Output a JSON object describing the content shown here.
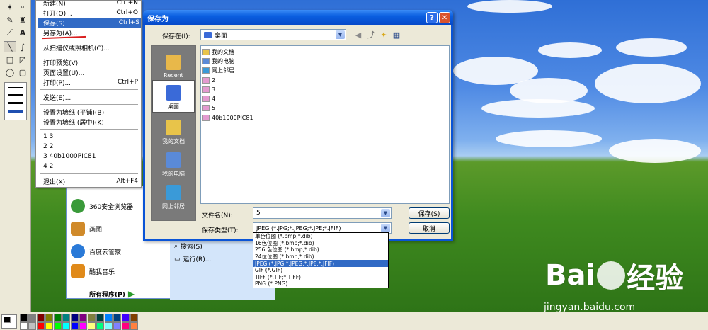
{
  "file_menu": {
    "items": [
      {
        "label": "新建(N)",
        "shortcut": "Ctrl+N"
      },
      {
        "label": "打开(O)...",
        "shortcut": "Ctrl+O"
      },
      {
        "label": "保存(S)",
        "shortcut": "Ctrl+S"
      },
      {
        "label": "另存为(A)...",
        "shortcut": ""
      },
      {
        "label": "从扫描仪或照相机(C)...",
        "shortcut": ""
      },
      {
        "label": "打印预览(V)",
        "shortcut": ""
      },
      {
        "label": "页面设置(U)...",
        "shortcut": ""
      },
      {
        "label": "打印(P)...",
        "shortcut": "Ctrl+P"
      },
      {
        "label": "发送(E)...",
        "shortcut": ""
      },
      {
        "label": "设置为墙纸 (平铺)(B)",
        "shortcut": ""
      },
      {
        "label": "设置为墙纸 (居中)(K)",
        "shortcut": ""
      },
      {
        "label": "1 3",
        "shortcut": ""
      },
      {
        "label": "2 2",
        "shortcut": ""
      },
      {
        "label": "3 40b1000PIC81",
        "shortcut": ""
      },
      {
        "label": "4 2",
        "shortcut": ""
      },
      {
        "label": "退出(X)",
        "shortcut": "Alt+F4"
      }
    ]
  },
  "start_menu": {
    "items": [
      {
        "label": "360安全浏览器",
        "color": "#3a9a3a"
      },
      {
        "label": "画图",
        "color": "#d08a2a"
      },
      {
        "label": "百度云管家",
        "color": "#2a7ad8"
      },
      {
        "label": "酷我音乐",
        "color": "#e08a1a"
      }
    ],
    "all_programs": "所有程序(P)",
    "search_label": "搜索(S)",
    "run_label": "运行(R)..."
  },
  "dialog": {
    "title": "保存为",
    "help_glyph": "?",
    "close_glyph": "✕",
    "save_in_label": "保存在(I):",
    "save_in_value": "桌面",
    "places": [
      {
        "label": "Recent",
        "color": "#e8b84a"
      },
      {
        "label": "桌面",
        "color": "#3a6ad8"
      },
      {
        "label": "我的文档",
        "color": "#e8c44a"
      },
      {
        "label": "我的电脑",
        "color": "#5a8ad8"
      },
      {
        "label": "网上邻居",
        "color": "#3a9ad8"
      }
    ],
    "files": [
      "我的文档",
      "我的电脑",
      "网上邻居",
      "2",
      "3",
      "4",
      "5",
      "40b1000PIC81"
    ],
    "filename_label": "文件名(N):",
    "filename_value": "5",
    "filetype_label": "保存类型(T):",
    "filetype_value": "JPEG (*.JPG;*.JPEG;*.JPE;*.JFIF)",
    "save_button": "保存(S)",
    "cancel_button": "取消",
    "filetype_options": [
      "单色位图 (*.bmp;*.dib)",
      "16色位图 (*.bmp;*.dib)",
      "256 色位图 (*.bmp;*.dib)",
      "24位位图 (*.bmp;*.dib)",
      "JPEG (*.JPG;*.JPEG;*.JPE;*.JFIF)",
      "GIF (*.GIF)",
      "TIFF (*.TIF;*.TIFF)",
      "PNG (*.PNG)"
    ]
  },
  "watermark": {
    "text_left": "Bai",
    "text_right": "经验",
    "url": "jingyan.baidu.com"
  },
  "palette_colors": [
    "#000000",
    "#808080",
    "#800000",
    "#808000",
    "#008000",
    "#008080",
    "#000080",
    "#800080",
    "#808040",
    "#004040",
    "#0080ff",
    "#004080",
    "#4000ff",
    "#804000",
    "#ffffff",
    "#c0c0c0",
    "#ff0000",
    "#ffff00",
    "#00ff00",
    "#00ffff",
    "#0000ff",
    "#ff00ff",
    "#ffff80",
    "#00ff80",
    "#80ffff",
    "#8080ff",
    "#ff0080",
    "#ff8040"
  ]
}
